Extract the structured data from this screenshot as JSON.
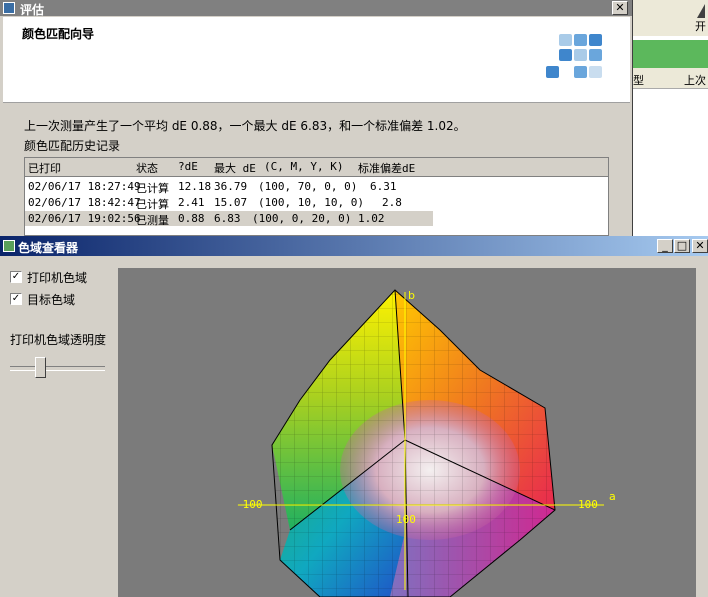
{
  "background_window": {
    "toolbar_label": "开",
    "headers": [
      "型",
      "上次"
    ]
  },
  "evaluation_window": {
    "title": "评估",
    "close_glyph": "✕",
    "wizard_title": "颜色匹配向导",
    "summary": "上一次测量产生了一个平均 dE 0.88，一个最大 dE 6.83，和一个标准偏差 1.02。",
    "history_label": "颜色匹配历史记录",
    "history_table": {
      "columns": [
        "已打印",
        "状态",
        "?dE",
        "最大 dE",
        "(C, M, Y, K)",
        "标准偏差dE"
      ],
      "rows": [
        {
          "printed": "02/06/17 18:27:49",
          "status": "已计算",
          "dE": "12.18",
          "max": "36.79",
          "cmyk": "(100, 70, 0, 0)",
          "std": "6.31"
        },
        {
          "printed": "02/06/17 18:42:47",
          "status": "已计算",
          "dE": "2.41",
          "max": "15.07",
          "cmyk": "(100, 10, 10, 0)",
          "std": "2.8"
        },
        {
          "printed": "02/06/17 19:02:56",
          "status": "已测量",
          "dE": "0.88",
          "max": "6.83",
          "cmyk": "(100, 0, 20, 0)",
          "std": "1.02"
        }
      ]
    }
  },
  "viewer_window": {
    "title": "色域查看器",
    "min_glyph": "_",
    "max_glyph": "□",
    "close_glyph": "✕",
    "printer_gamut_label": "打印机色域",
    "printer_gamut_checked": true,
    "target_gamut_label": "目标色域",
    "target_gamut_checked": true,
    "transparency_label": "打印机色域透明度",
    "transparency_value": 0.3,
    "check_glyph": "✓",
    "axis_labels": {
      "b": "b",
      "a": "a",
      "neg_a_tick": "-100",
      "pos_a_tick": "100",
      "center_tick": "100"
    }
  },
  "colors": {
    "viewer_bg": "#7b7b7b",
    "axis_label": "#ffff00",
    "title_active_start": "#0a246a",
    "title_active_end": "#a6caf0",
    "title_inactive": "#808080"
  }
}
